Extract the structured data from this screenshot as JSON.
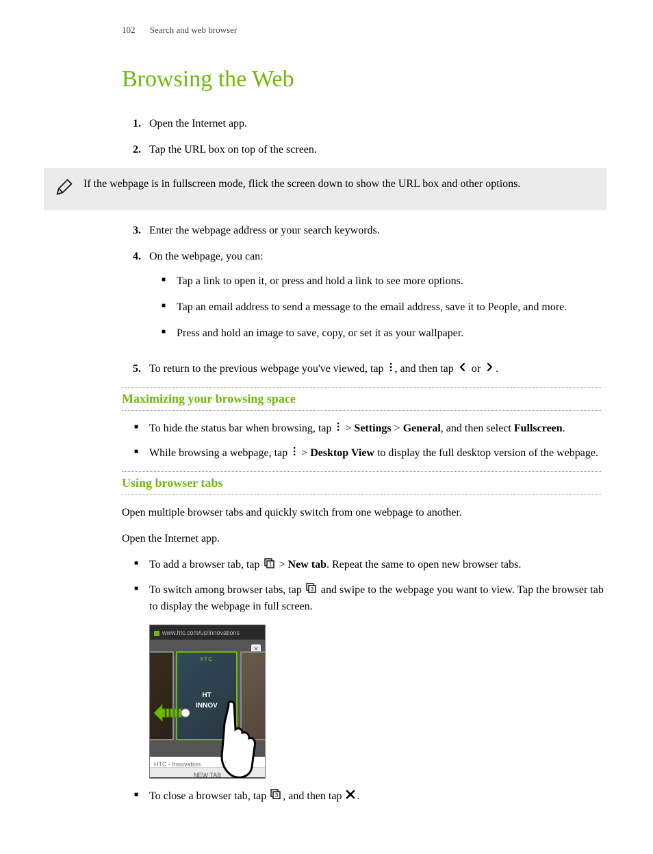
{
  "header": {
    "page_number": "102",
    "section": "Search and web browser"
  },
  "title": "Browsing the Web",
  "step1": {
    "num": "1.",
    "text": "Open the Internet app."
  },
  "step2": {
    "num": "2.",
    "text": "Tap the URL box on top of the screen."
  },
  "note1": "If the webpage is in fullscreen mode, flick the screen down to show the URL box and other options.",
  "step3": {
    "num": "3.",
    "text": "Enter the webpage address or your search keywords."
  },
  "step4": {
    "num": "4.",
    "lead": "On the webpage, you can:",
    "b1": "Tap a link to open it, or press and hold a link to see more options.",
    "b2": "Tap an email address to send a message to the email address, save it to People, and more.",
    "b3": "Press and hold an image to save, copy, or set it as your wallpaper."
  },
  "step5": {
    "num": "5.",
    "pre": "To return to the previous webpage you've viewed, tap ",
    "mid": ", and then tap ",
    "or": " or ",
    "post": "."
  },
  "sec_max": "Maximizing your browsing space",
  "max_b1": {
    "pre": "To hide the status bar when browsing, tap ",
    "gt1": " > ",
    "settings": "Settings",
    "gt2": " > ",
    "general": "General",
    "mid": ", and then select ",
    "fullscreen": "Fullscreen",
    "post": "."
  },
  "max_b2": {
    "pre": "While browsing a webpage, tap ",
    "gt": " > ",
    "desktop": "Desktop View",
    "post": " to display the full desktop version of the webpage."
  },
  "sec_tabs": "Using browser tabs",
  "tabs_p1": "Open multiple browser tabs and quickly switch from one webpage to another.",
  "tabs_p2": "Open the Internet app.",
  "tabs_b1": {
    "pre": "To add a browser tab, tap ",
    "gt": " > ",
    "newtab": "New tab",
    "post": ". Repeat the same to open new browser tabs."
  },
  "tabs_b2": {
    "pre": "To switch among browser tabs, tap ",
    "post": " and swipe to the webpage you want to view. Tap the browser tab to display the webpage in full screen."
  },
  "tabs_b3": {
    "pre": "To close a browser tab, tap ",
    "mid": ", and then tap ",
    "post": "."
  },
  "phone": {
    "url": "www.htc.com/us/innovations",
    "brand": "hTC",
    "overlay1": "HT",
    "overlay2": "INNOV",
    "caption": "HTC - Innovation",
    "newtab": "NEW TAB"
  },
  "icons": {
    "tab1_num": "1",
    "tab3_num": "3"
  }
}
